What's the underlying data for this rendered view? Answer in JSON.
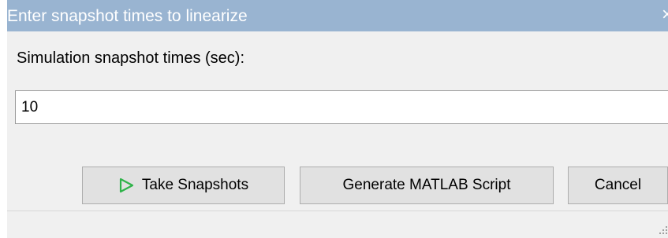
{
  "window": {
    "title": "Enter snapshot times to linearize",
    "close_symbol": "×"
  },
  "form": {
    "label": "Simulation snapshot times (sec):",
    "value": "10"
  },
  "buttons": {
    "take_snapshots": "Take Snapshots",
    "generate_script": "Generate MATLAB Script",
    "cancel": "Cancel"
  },
  "icons": {
    "play": "play-icon",
    "play_color": "#2fb34a",
    "close": "close-icon",
    "resize_grip": "resize-grip-icon"
  },
  "colors": {
    "titlebar": "#99b4d1",
    "dialog_background": "#f0f0f0",
    "button_background": "#e1e1e1"
  }
}
